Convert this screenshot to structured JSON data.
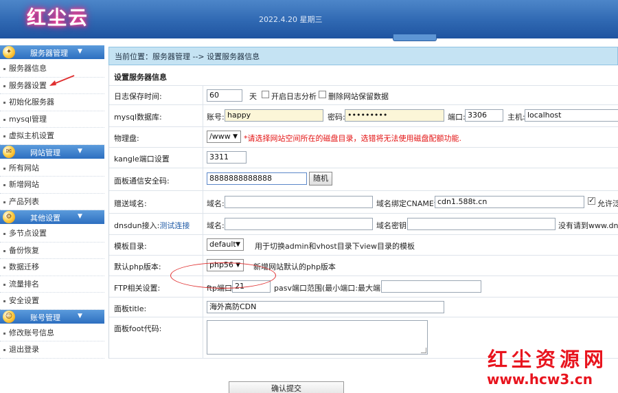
{
  "header": {
    "logo_text": "红尘云",
    "date": "2022.4.20 星期三"
  },
  "sidebar": {
    "groups": [
      {
        "title": "服务器管理",
        "items": [
          "服务器信息",
          "服务器设置",
          "初始化服务器",
          "mysql管理",
          "虚拟主机设置"
        ]
      },
      {
        "title": "网站管理",
        "items": [
          "所有网站",
          "新增网站",
          "产品列表"
        ]
      },
      {
        "title": "其他设置",
        "items": [
          "多节点设置",
          "备份恢复",
          "数据迁移",
          "流量排名",
          "安全设置"
        ]
      },
      {
        "title": "账号管理",
        "items": [
          "修改账号信息",
          "退出登录"
        ]
      }
    ]
  },
  "main": {
    "breadcrumb": "当前位置：服务器管理 --> 设置服务器信息",
    "section_title": "设置服务器信息",
    "log": {
      "label": "日志保存时间:",
      "value": "60",
      "unit": "天",
      "opt1": "开启日志分析",
      "opt2": "删除网站保留数据"
    },
    "mysql": {
      "label": "mysql数据库:",
      "user_label": "账号:",
      "user": "happy",
      "pwd_label": "密码:",
      "pwd": "•••••••••",
      "port_label": "端口:",
      "port": "3306",
      "host_label": "主机:",
      "host": "localhost"
    },
    "disk": {
      "label": "物理盘:",
      "value": "/www",
      "warn": "*请选择网站空间所在的磁盘目录，选错将无法使用磁盘配额功能."
    },
    "kangle": {
      "label": "kangle端口设置",
      "value": "3311"
    },
    "code": {
      "label": "面板通信安全码:",
      "value": "8888888888888",
      "btn": "随机"
    },
    "domain": {
      "label": "赠送域名:",
      "domain_label": "域名:",
      "cname_label": "域名绑定CNAME记录",
      "cname": "cdn1.588t.cn",
      "allow": "允许泛"
    },
    "dnsdun": {
      "label": "dnsdun接入:",
      "link": "测试连接",
      "domain_label": "域名:",
      "key_label": "域名密钥:",
      "hint": "没有请到www.dnsdun"
    },
    "template": {
      "label": "模板目录:",
      "value": "default",
      "hint": "用于切换admin和vhost目录下view目录的模板"
    },
    "php": {
      "label": "默认php版本:",
      "value": "php56",
      "hint": "新增网站默认的php版本"
    },
    "ftp": {
      "label": "FTP相关设置:",
      "port_label": "ftp端口",
      "port": "21",
      "pasv_label": "pasv端口范围(最小端口:最大端口)"
    },
    "title": {
      "label": "面板title:",
      "value": "海外高防CDN"
    },
    "foot": {
      "label": "面板foot代码:"
    },
    "submit": "确认提交"
  },
  "watermark": {
    "line1": "红尘资源网",
    "line2": "www.hcw3.cn"
  },
  "colors": {
    "banner": "#2f68b2",
    "accent_red": "#e31212",
    "crumb_bg": "#c5e3f3"
  }
}
